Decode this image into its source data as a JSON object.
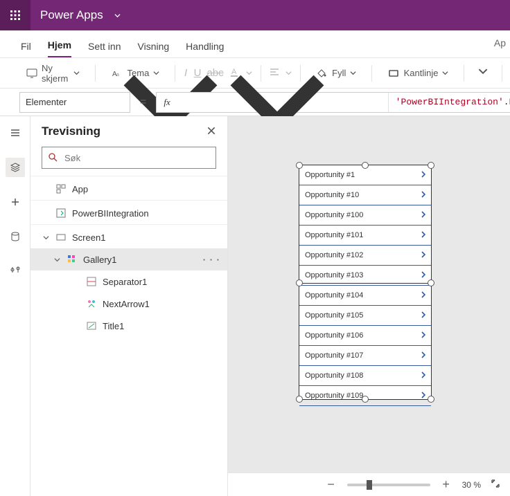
{
  "titlebar": {
    "app_name": "Power Apps"
  },
  "menu": {
    "file": "Fil",
    "home": "Hjem",
    "insert": "Sett inn",
    "view": "Visning",
    "action": "Handling",
    "right_stub": "Ap"
  },
  "ribbon": {
    "new_screen": "Ny skjerm",
    "theme": "Tema",
    "fill": "Fyll",
    "border": "Kantlinje"
  },
  "propbar": {
    "property": "Elementer",
    "fx": "fx",
    "formula_literal": "'PowerBIIntegration'",
    "formula_suffix": ".Data"
  },
  "tree": {
    "panel_title": "Trevisning",
    "search_placeholder": "Søk",
    "app": "App",
    "pbi": "PowerBIIntegration",
    "screen1": "Screen1",
    "gallery1": "Gallery1",
    "separator1": "Separator1",
    "nextarrow1": "NextArrow1",
    "title1": "Title1",
    "more": "· · ·"
  },
  "gallery_items": [
    "Opportunity #1",
    "Opportunity #10",
    "Opportunity #100",
    "Opportunity #101",
    "Opportunity #102",
    "Opportunity #103",
    "Opportunity #104",
    "Opportunity #105",
    "Opportunity #106",
    "Opportunity #107",
    "Opportunity #108",
    "Opportunity #109"
  ],
  "status": {
    "zoom_value": "30",
    "zoom_suffix": "%"
  }
}
